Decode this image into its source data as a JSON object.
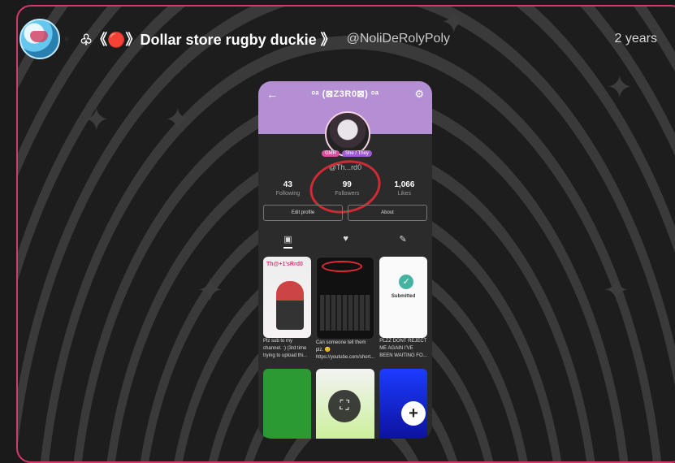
{
  "post": {
    "author_display": "♧《🔴》Dollar store rugby duckie 》",
    "author_handle": "@NoliDeRolyPoly",
    "time_ago": "2 years"
  },
  "embedded_screenshot": {
    "profile_name": "ᵒᵃ (⊠Z3R0⊠) ᵒᵃ",
    "badge_left": "GMR",
    "badge_right": "She / They",
    "username": "@Th...rd0",
    "stats": [
      {
        "value": "43",
        "label": "Following"
      },
      {
        "value": "99",
        "label": "Followers"
      },
      {
        "value": "1,066",
        "label": "Likes"
      }
    ],
    "buttons": {
      "edit": "Edit profile",
      "about": "About"
    },
    "tabs": {
      "grid": "▣",
      "likes": "♥",
      "edit": "✎"
    },
    "tiles": [
      {
        "title": "Th@+1'sRrd0",
        "caption": "Plz sub to my channel. :) (3rd time trying to upload thi..."
      },
      {
        "title": "",
        "caption": "Can someone tell them plz. 😐 https://youtube.com/short..."
      },
      {
        "title": "Submitted",
        "caption": "PLZZ DONT REJECT ME AGAIN I'VE BEEN WAITING FO..."
      }
    ]
  },
  "controls": {
    "expand_icon": "⛶",
    "add_icon": "+"
  },
  "colors": {
    "accent": "#d63a6a",
    "header_bg": "#b48fd3"
  }
}
